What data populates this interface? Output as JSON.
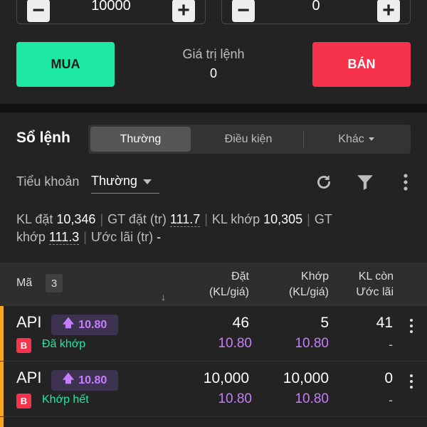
{
  "order_form": {
    "quantity_value": "10000",
    "price_value": "0",
    "buy_label": "MUA",
    "sell_label": "BÁN",
    "order_value_label": "Giá trị lệnh",
    "order_value": "0"
  },
  "order_book": {
    "title": "Sổ lệnh",
    "tabs": [
      {
        "label": "Thường",
        "active": true
      },
      {
        "label": "Điều kiện",
        "active": false
      },
      {
        "label": "Khác",
        "active": false
      }
    ],
    "subaccount_label": "Tiểu khoản",
    "subaccount_value": "Thường",
    "stats": {
      "kl_dat_label": "KL đặt",
      "kl_dat": "10,346",
      "gt_dat_label": "GT đặt (tr)",
      "gt_dat": "111.7",
      "kl_khop_label": "KL khớp",
      "kl_khop": "10,305",
      "gt_khop_label_1": "GT",
      "gt_khop_label_2": "khớp",
      "gt_khop": "111.3",
      "uoc_lai_label": "Ước lãi (tr)",
      "uoc_lai": "-"
    },
    "columns": {
      "ma": "Mã",
      "count": "3",
      "dat_1": "Đặt",
      "dat_2": "(KL/giá)",
      "khop_1": "Khớp",
      "khop_2": "(KL/giá)",
      "kl_con": "KL còn",
      "uoc_lai": "Ước lãi",
      "sort_arrow": "↓"
    },
    "rows": [
      {
        "symbol": "API",
        "price": "10.80",
        "side": "B",
        "status": "Đã khớp",
        "dat_qty": "46",
        "dat_price": "10.80",
        "khop_qty": "5",
        "khop_price": "10.80",
        "kl_con": "41",
        "uoc_lai": "-"
      },
      {
        "symbol": "API",
        "price": "10.80",
        "side": "B",
        "status": "Khớp hết",
        "dat_qty": "10,000",
        "dat_price": "10.80",
        "khop_qty": "10,000",
        "khop_price": "10.80",
        "kl_con": "0",
        "uoc_lai": "-"
      }
    ]
  },
  "colors": {
    "buy": "#1de9a4",
    "sell": "#f5334b",
    "price_purple": "#c77dff",
    "row_marker": "#f5a623"
  }
}
